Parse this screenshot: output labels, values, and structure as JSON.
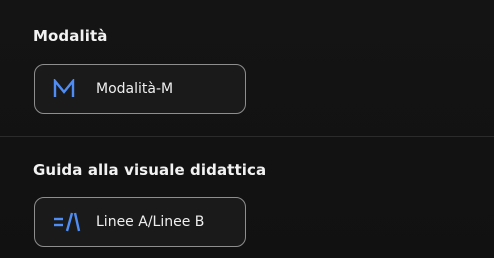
{
  "sections": {
    "mode": {
      "title": "Modalità",
      "button_label": "Modalità-M",
      "icon": "m-letter-icon"
    },
    "guide": {
      "title": "Guida alla visuale didattica",
      "button_label": "Linee A/Linee B",
      "icon": "lines-icon"
    }
  },
  "colors": {
    "background": "#121212",
    "accent": "#4f8df5",
    "border": "#8e8e8e",
    "text": "#efefef"
  }
}
